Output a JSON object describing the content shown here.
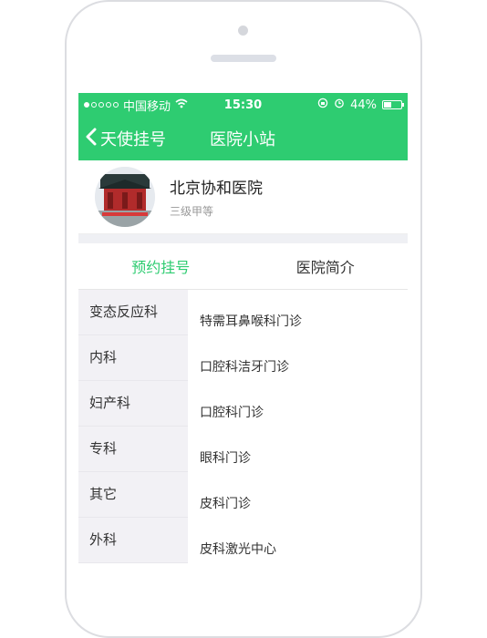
{
  "status_bar": {
    "carrier": "中国移动",
    "time": "15:30",
    "battery": "44%",
    "battery_level": 0.44,
    "signal_bars_filled": 1,
    "signal_bars_total": 5
  },
  "nav": {
    "back_label": "天使挂号",
    "title": "医院小站"
  },
  "hospital": {
    "name": "北京协和医院",
    "level": "三级甲等"
  },
  "tabs": [
    {
      "label": "预约挂号",
      "active": true
    },
    {
      "label": "医院简介",
      "active": false
    }
  ],
  "departments": [
    {
      "label": "变态反应科"
    },
    {
      "label": "内科"
    },
    {
      "label": "妇产科"
    },
    {
      "label": "专科"
    },
    {
      "label": "其它"
    },
    {
      "label": "外科"
    }
  ],
  "clinics": [
    {
      "label": "特需耳鼻喉科门诊"
    },
    {
      "label": "口腔科洁牙门诊"
    },
    {
      "label": "口腔科门诊"
    },
    {
      "label": "眼科门诊"
    },
    {
      "label": "皮科门诊"
    },
    {
      "label": "皮科激光中心"
    }
  ],
  "colors": {
    "accent": "#2ecc71",
    "sidebar_bg": "#f2f1f5",
    "divider_bg": "#eff0f4"
  },
  "icons": {
    "back": "chevron-left-icon",
    "wifi": "wifi-icon",
    "lock_rotation": "rotation-lock-icon",
    "alarm": "alarm-icon",
    "battery": "battery-icon"
  }
}
